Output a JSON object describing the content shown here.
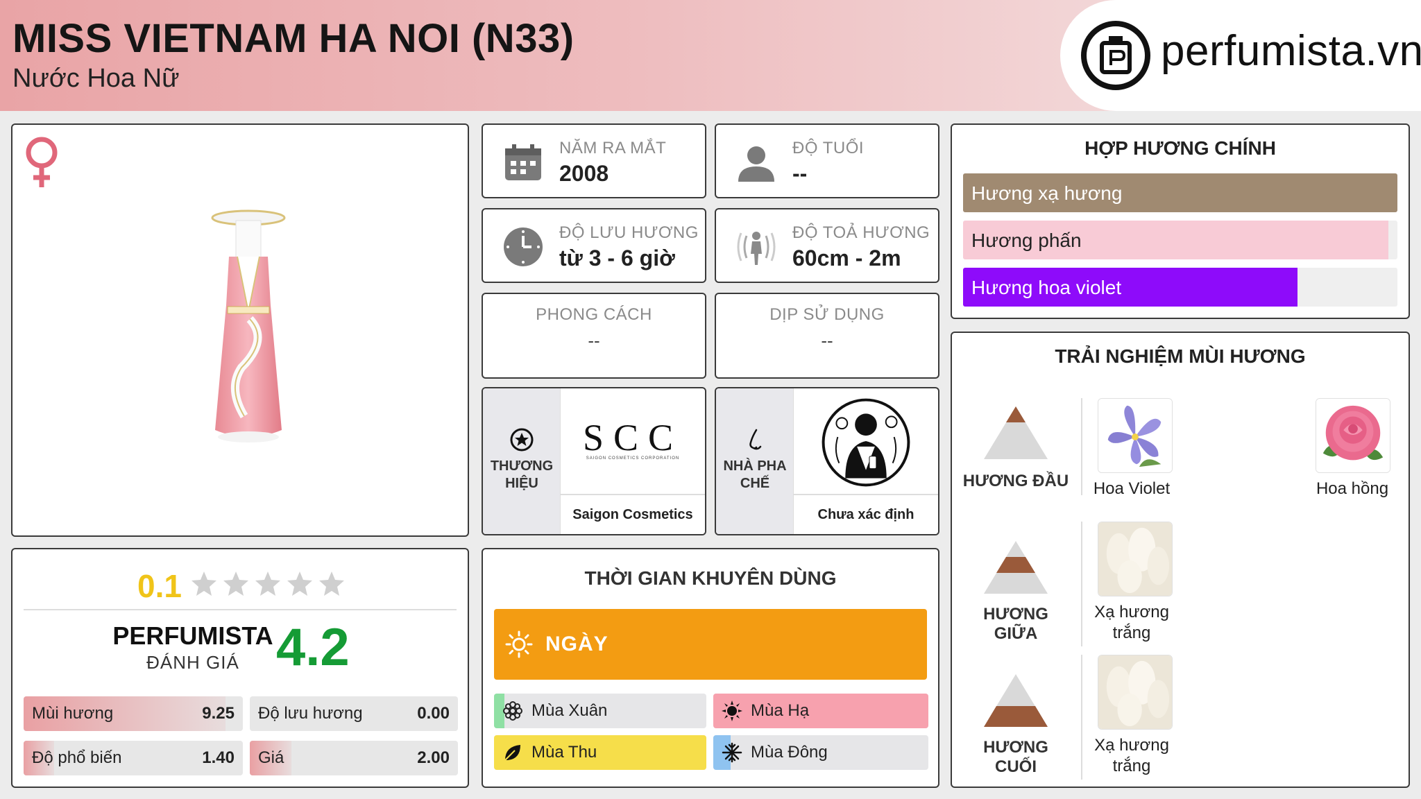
{
  "header": {
    "title": "MISS VIETNAM HA NOI (N33)",
    "subtitle": "Nước Hoa Nữ",
    "logo_text": "perfumista.vn"
  },
  "info": {
    "launch": {
      "label": "NĂM RA MẮT",
      "value": "2008",
      "icon": "calendar-icon"
    },
    "age": {
      "label": "ĐỘ TUỔI",
      "value": "--",
      "icon": "person-icon"
    },
    "longevity": {
      "label": "ĐỘ LƯU HƯƠNG",
      "value": "từ 3 - 6 giờ",
      "icon": "clock-icon"
    },
    "sillage": {
      "label": "ĐỘ TOẢ HƯƠNG",
      "value": "60cm - 2m",
      "icon": "sillage-icon"
    },
    "style": {
      "label": "PHONG CÁCH",
      "value": "--"
    },
    "occasion": {
      "label": "DỊP SỬ DỤNG",
      "value": "--"
    }
  },
  "brand": {
    "side_label_1": "THƯƠNG",
    "side_label_2": "HIỆU",
    "logo_text": "SCC",
    "logo_subtext": "SAIGON COSMETICS CORPORATION",
    "name": "Saigon Cosmetics"
  },
  "perfumer": {
    "side_label_1": "NHÀ PHA",
    "side_label_2": "CHẾ",
    "name": "Chưa xác định"
  },
  "rating": {
    "user_score": "0.1",
    "stars_filled": 0,
    "stars_total": 5,
    "pf_title": "PERFUMISTA",
    "pf_sub": "ĐÁNH GIÁ",
    "pf_score": "4.2",
    "metrics": [
      {
        "label": "Mùi hương",
        "value": "9.25",
        "fraction": 0.92
      },
      {
        "label": "Độ lưu hương",
        "value": "0.00",
        "fraction": 0.0
      },
      {
        "label": "Độ phổ biến",
        "value": "1.40",
        "fraction": 0.14
      },
      {
        "label": "Giá",
        "value": "2.00",
        "fraction": 0.2
      }
    ],
    "colors": {
      "star_empty": "#cfcfcf",
      "score_small": "#f0c419",
      "pf_score": "#159b35",
      "metric_fill": "#e9a0a3"
    }
  },
  "time": {
    "title": "THỜI GIAN KHUYÊN DÙNG",
    "day_label": "NGÀY",
    "day_color": "#f39c12",
    "seasons": [
      {
        "label": "Mùa Xuân",
        "icon": "flower-icon",
        "accent": "#8fe0a4",
        "fraction": 0.05
      },
      {
        "label": "Mùa Hạ",
        "icon": "sun-icon",
        "accent": "#f7a1ae",
        "fraction": 1.0
      },
      {
        "label": "Mùa Thu",
        "icon": "leaf-icon",
        "accent": "#f6de4a",
        "fraction": 1.0
      },
      {
        "label": "Mùa Đông",
        "icon": "snowflake-icon",
        "accent": "#8fc3f0",
        "fraction": 0.08
      }
    ]
  },
  "accords": {
    "title": "HỢP HƯƠNG CHÍNH",
    "items": [
      {
        "label": "Hương xạ hương",
        "color": "#a08a71",
        "text_color": "#ffffff",
        "fraction": 1.0
      },
      {
        "label": "Hương phấn",
        "color": "#f8cbd6",
        "text_color": "#222222",
        "fraction": 0.98
      },
      {
        "label": "Hương hoa violet",
        "color": "#8e0bfa",
        "text_color": "#ffffff",
        "fraction": 0.77
      }
    ]
  },
  "experience": {
    "title": "TRẢI NGHIỆM MÙI HƯƠNG",
    "tiers": [
      {
        "label": "HƯƠNG ĐẦU",
        "notes": [
          "Hoa Violet",
          "Hoa hồng"
        ]
      },
      {
        "label": "HƯƠNG GIỮA",
        "notes": [
          "Xạ hương trắng"
        ]
      },
      {
        "label": "HƯƠNG CUỐI",
        "notes": [
          "Xạ hương trắng"
        ]
      }
    ]
  }
}
